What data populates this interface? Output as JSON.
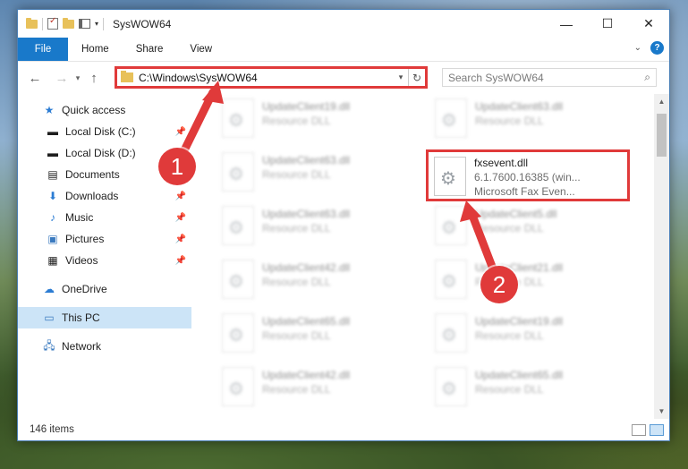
{
  "window": {
    "title": "SysWOW64"
  },
  "ribbon": {
    "tabs": [
      "File",
      "Home",
      "Share",
      "View"
    ]
  },
  "address": {
    "path": "C:\\Windows\\SysWOW64"
  },
  "search": {
    "placeholder": "Search SysWOW64"
  },
  "sidebar": {
    "items": [
      {
        "label": "Quick access",
        "icon": "star-icon"
      },
      {
        "label": "Local Disk (C:)",
        "icon": "drive-icon",
        "pinned": true
      },
      {
        "label": "Local Disk (D:)",
        "icon": "drive-icon"
      },
      {
        "label": "Documents",
        "icon": "documents-icon",
        "pinned": true
      },
      {
        "label": "Downloads",
        "icon": "download-icon",
        "pinned": true
      },
      {
        "label": "Music",
        "icon": "music-icon",
        "pinned": true
      },
      {
        "label": "Pictures",
        "icon": "pictures-icon",
        "pinned": true
      },
      {
        "label": "Videos",
        "icon": "videos-icon",
        "pinned": true
      },
      {
        "label": "OneDrive",
        "icon": "cloud-icon"
      },
      {
        "label": "This PC",
        "icon": "computer-icon",
        "selected": true
      },
      {
        "label": "Network",
        "icon": "network-icon"
      }
    ]
  },
  "files": [
    {
      "name": "UpdateClient19.dll",
      "desc": "Resource DLL"
    },
    {
      "name": "UpdateClient63.dll",
      "desc": "Resource DLL"
    },
    {
      "name": "UpdateClient63.dll",
      "desc": "Resource DLL"
    },
    {
      "name": "fxsevent.dll",
      "line2": "6.1.7600.16385 (win...",
      "line3": "Microsoft  Fax Even..."
    },
    {
      "name": "UpdateClient63.dll",
      "desc": "Resource DLL"
    },
    {
      "name": "UpdateClient5.dll",
      "desc": "Resource DLL"
    },
    {
      "name": "UpdateClient42.dll",
      "desc": "Resource DLL"
    },
    {
      "name": "UpdateClient21.dll",
      "desc": "Resource DLL"
    },
    {
      "name": "UpdateClient65.dll",
      "desc": "Resource DLL"
    },
    {
      "name": "UpdateClient19.dll",
      "desc": "Resource DLL"
    },
    {
      "name": "UpdateClient42.dll",
      "desc": "Resource DLL"
    },
    {
      "name": "UpdateClient65.dll",
      "desc": "Resource DLL"
    }
  ],
  "status": {
    "count": "146 items"
  },
  "annotations": {
    "badge1": "1",
    "badge2": "2",
    "color": "#e03a3a"
  }
}
